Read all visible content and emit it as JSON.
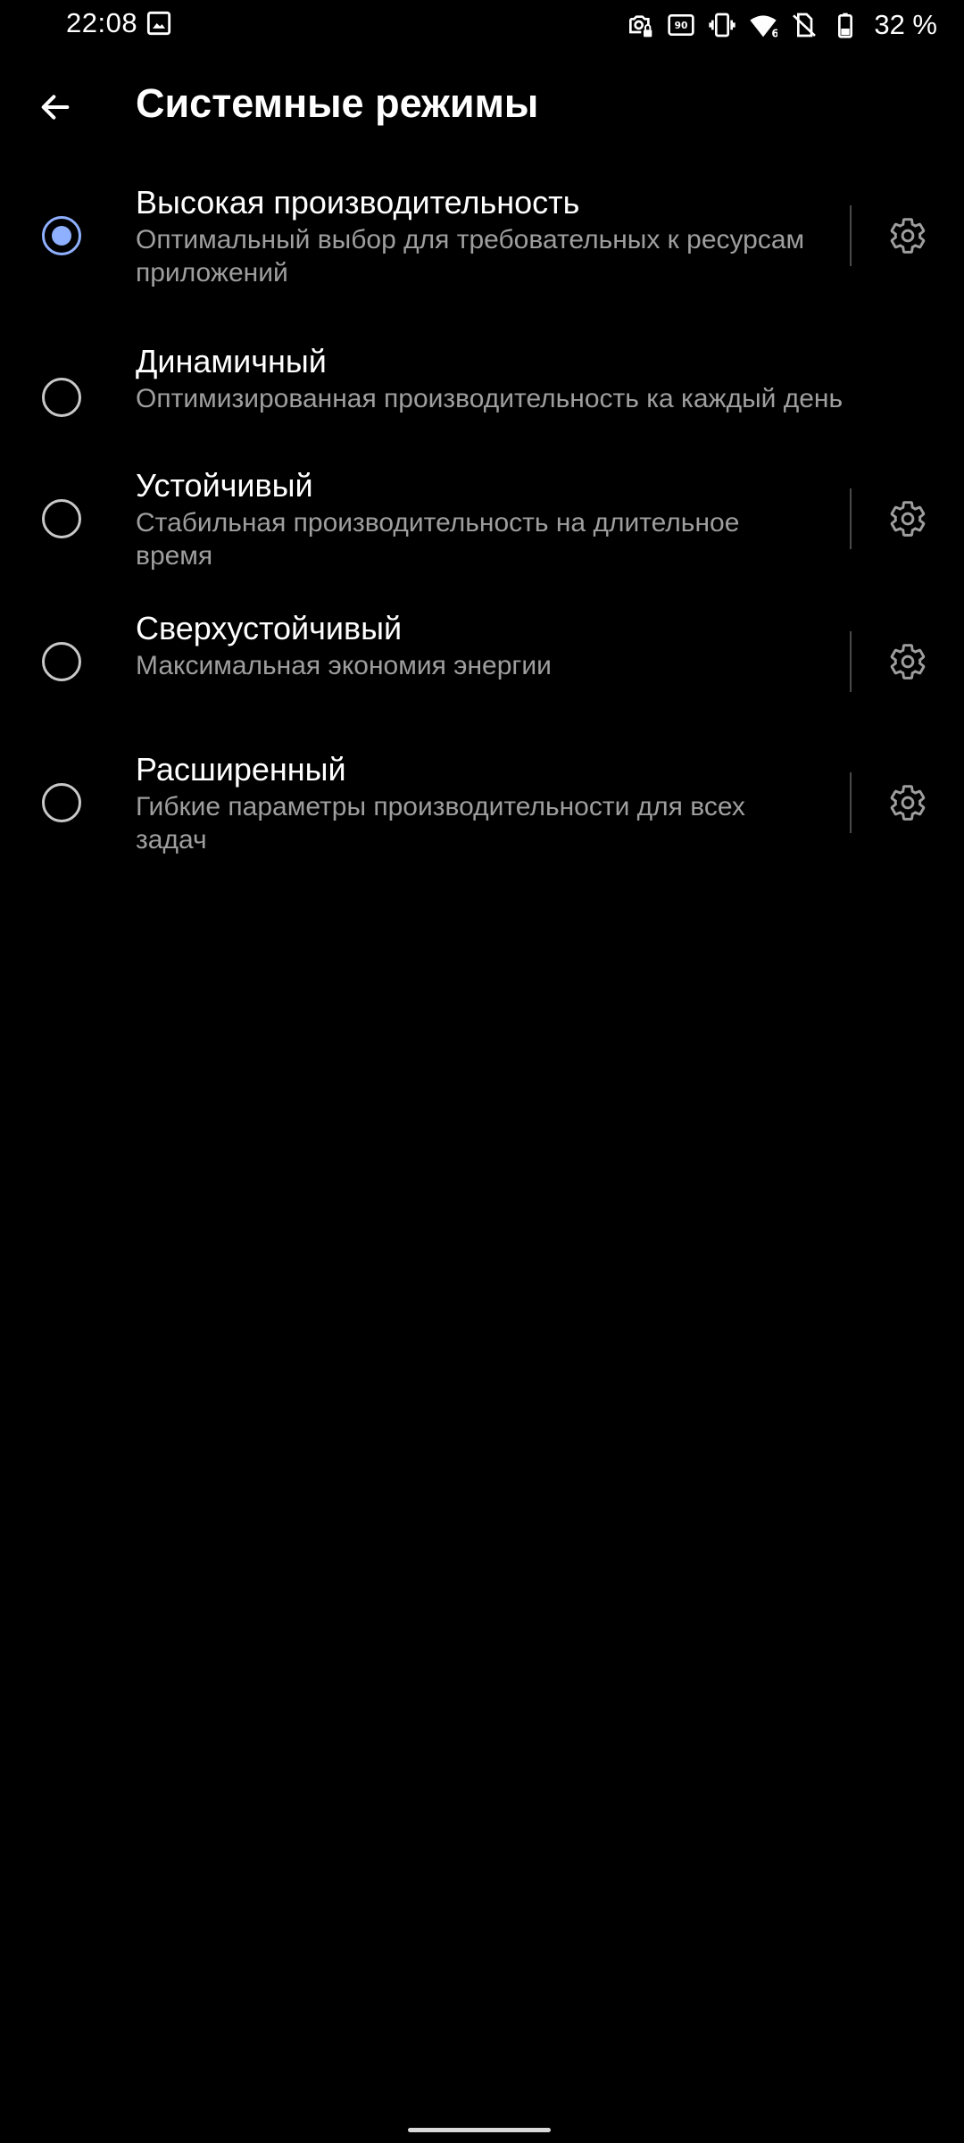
{
  "status_bar": {
    "time": "22:08",
    "battery_text": "32 %",
    "icons": [
      "gallery-icon",
      "camera-lock-icon",
      "refresh-rate-90hz-icon",
      "vibrate-icon",
      "wifi-6-icon",
      "no-sim-icon",
      "battery-icon"
    ],
    "refresh_rate_label": "90"
  },
  "header": {
    "title": "Системные режимы",
    "back_icon": "arrow-back-icon"
  },
  "modes": [
    {
      "title": "Высокая производительность",
      "description": "Оптимальный выбор для требовательных к ресурсам приложений",
      "selected": true,
      "has_settings": true
    },
    {
      "title": "Динамичный",
      "description": "Оптимизированная производительность ка каждый день",
      "selected": false,
      "has_settings": false
    },
    {
      "title": "Устойчивый",
      "description": "Стабильная производительность на длительное время",
      "selected": false,
      "has_settings": true
    },
    {
      "title": "Сверхустойчивый",
      "description": "Максимальная экономия энергии",
      "selected": false,
      "has_settings": true
    },
    {
      "title": "Расширенный",
      "description": "Гибкие параметры производительности для всех задач",
      "selected": false,
      "has_settings": true
    }
  ],
  "colors": {
    "background": "#000000",
    "accent": "#8fb0ff",
    "title_text": "#ffffff",
    "secondary_text": "#9e9e9e",
    "divider": "#4a4a4a",
    "gear": "#9e9e9e"
  }
}
